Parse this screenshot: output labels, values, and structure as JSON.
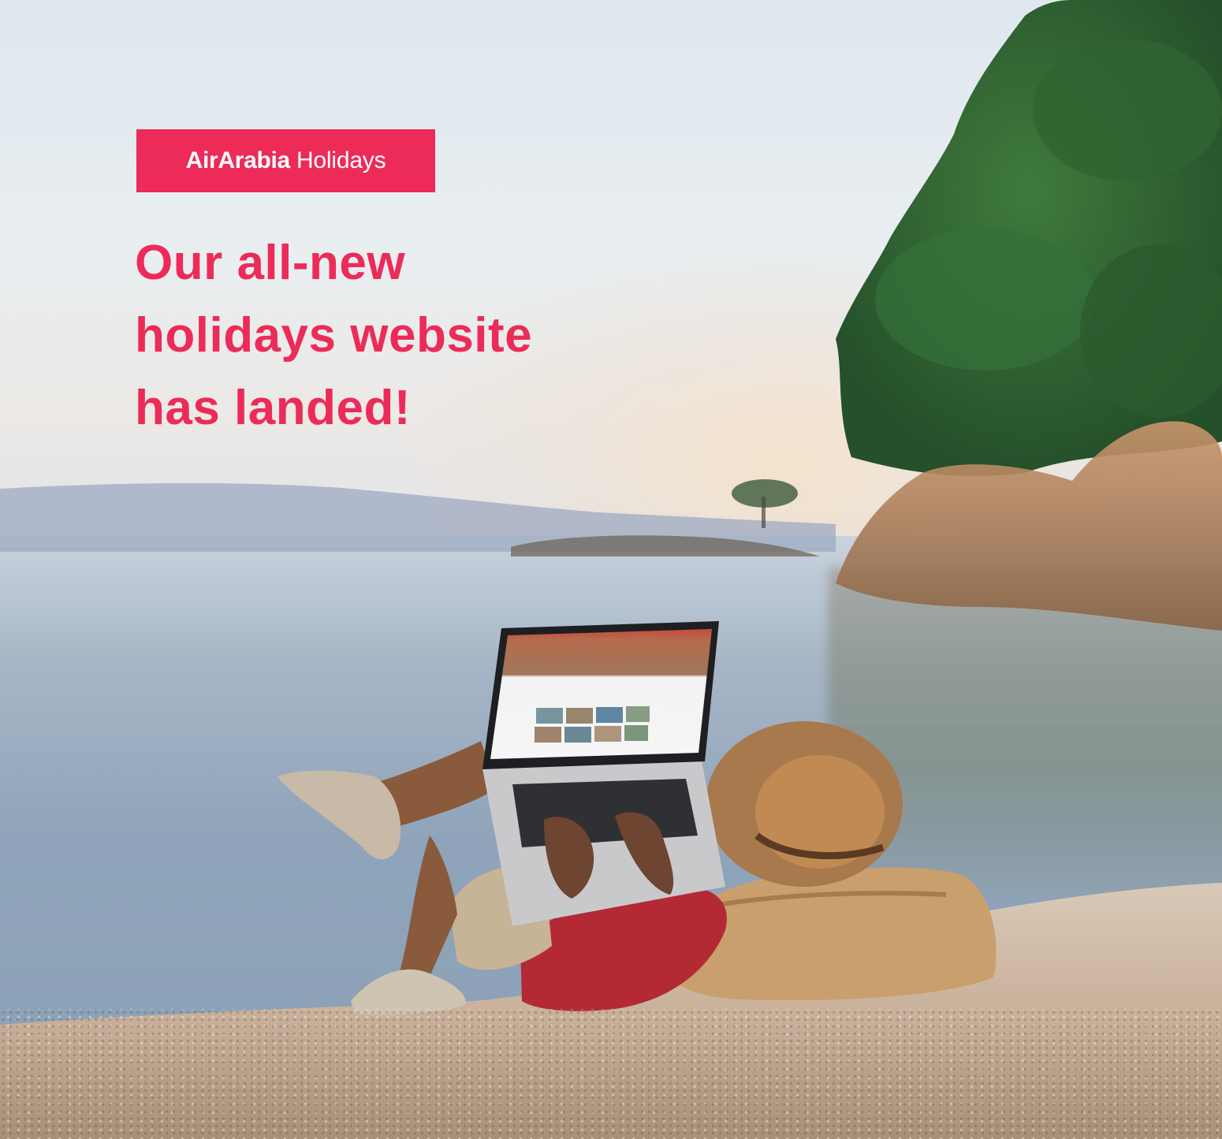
{
  "brand": {
    "name": "AirArabia",
    "suffix": "Holidays",
    "accent_color": "#ec2b58"
  },
  "headline": {
    "line1": "Our all-new",
    "line2": "holidays website",
    "line3": "has landed!"
  },
  "photo": {
    "icon": "beach-laptop-photo"
  }
}
